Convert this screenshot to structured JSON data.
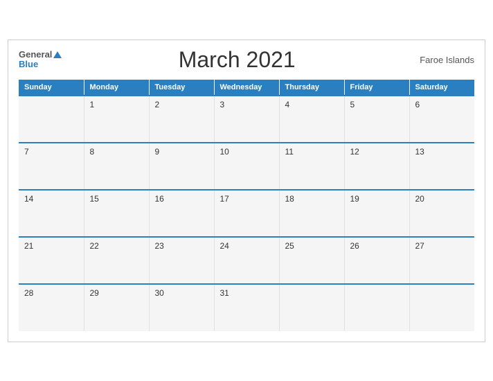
{
  "header": {
    "logo_general": "General",
    "logo_blue": "Blue",
    "title": "March 2021",
    "region": "Faroe Islands"
  },
  "days_of_week": [
    "Sunday",
    "Monday",
    "Tuesday",
    "Wednesday",
    "Thursday",
    "Friday",
    "Saturday"
  ],
  "weeks": [
    [
      "",
      "1",
      "2",
      "3",
      "4",
      "5",
      "6"
    ],
    [
      "7",
      "8",
      "9",
      "10",
      "11",
      "12",
      "13"
    ],
    [
      "14",
      "15",
      "16",
      "17",
      "18",
      "19",
      "20"
    ],
    [
      "21",
      "22",
      "23",
      "24",
      "25",
      "26",
      "27"
    ],
    [
      "28",
      "29",
      "30",
      "31",
      "",
      "",
      ""
    ]
  ]
}
